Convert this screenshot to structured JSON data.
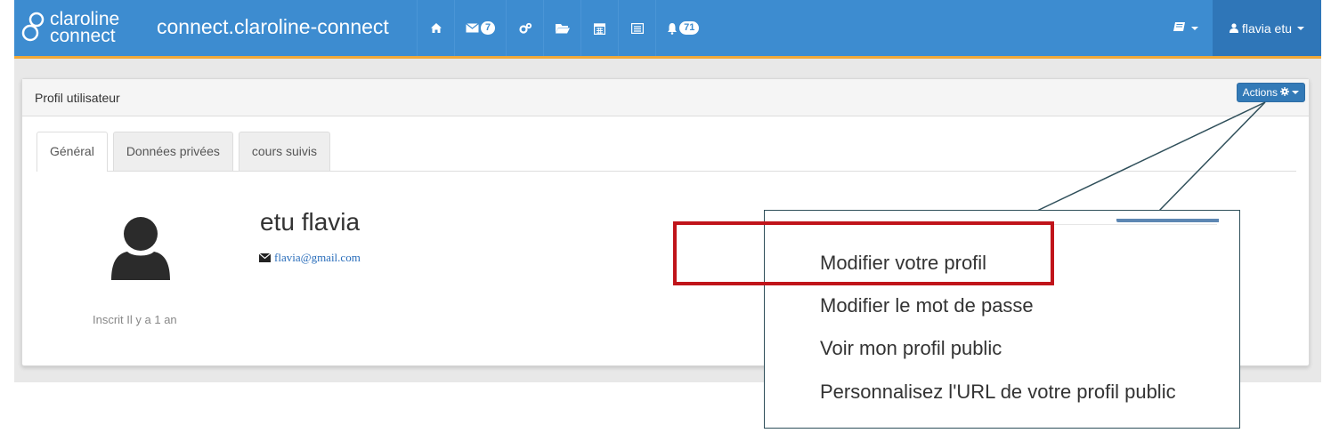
{
  "navbar": {
    "logo": {
      "line1": "claroline",
      "line2": "connect"
    },
    "site_title": "connect.claroline-connect",
    "icons": [
      {
        "name": "home-icon"
      },
      {
        "name": "envelope-icon",
        "badge": "7"
      },
      {
        "name": "cogs-icon"
      },
      {
        "name": "folder-icon"
      },
      {
        "name": "calendar-icon"
      },
      {
        "name": "list-icon"
      },
      {
        "name": "bell-icon",
        "badge": "71"
      }
    ],
    "user_label": "flavia etu"
  },
  "panel": {
    "title": "Profil utilisateur",
    "actions_label": "Actions",
    "tabs": [
      {
        "label": "Général",
        "active": true
      },
      {
        "label": "Données privées",
        "active": false
      },
      {
        "label": "cours suivis",
        "active": false
      }
    ],
    "profile": {
      "name": "etu flavia",
      "email": "flavia@gmail.com",
      "inscrit": "Inscrit Il y a 1 an"
    }
  },
  "actions_menu": {
    "items": [
      "Modifier votre profil",
      "Modifier le mot de passe",
      "Voir mon profil public",
      "Personnalisez l'URL de votre profil public"
    ],
    "highlighted_item": "Modifier votre profil"
  },
  "colors": {
    "navbar": "#3d8cd0",
    "navbar_accent": "#f0a93a",
    "user_dropdown": "#2f76b8",
    "highlight": "#c0141a",
    "callout_border": "#2f4f5a"
  }
}
